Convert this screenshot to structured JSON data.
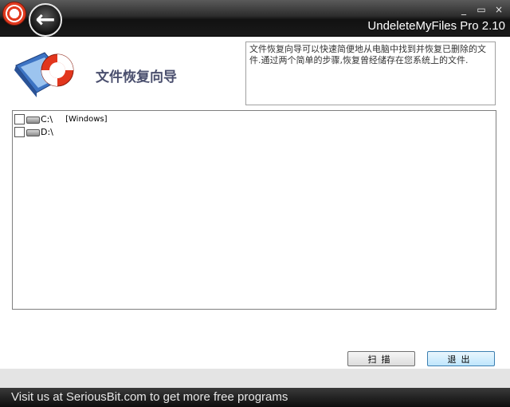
{
  "window": {
    "title": "UndeleteMyFiles Pro 2.10",
    "controls": {
      "minimize": "_",
      "maximize": "▭",
      "close": "×"
    }
  },
  "header": {
    "title": "文件恢复向导",
    "description": "文件恢复向导可以快速简便地从电脑中找到并恢复已删除的文件.通过两个简单的步骤,恢复曾经储存在您系统上的文件."
  },
  "drives": [
    {
      "letter": "C:\\",
      "label": "[Windows]",
      "checked": false
    },
    {
      "letter": "D:\\",
      "label": "",
      "checked": false
    }
  ],
  "buttons": {
    "scan": "扫描",
    "exit": "退出"
  },
  "footer": {
    "text": "Visit us at SeriousBit.com to get more free programs"
  },
  "icons": {
    "app_logo": "lifebuoy-icon",
    "back": "back-arrow-icon",
    "wizard": "lifebuoy-folder-icon",
    "drive": "hard-drive-icon"
  },
  "colors": {
    "title_text": "#4a4f6e",
    "footer_bg": "#1a1a1a",
    "accent_button": "#bee6fd"
  }
}
